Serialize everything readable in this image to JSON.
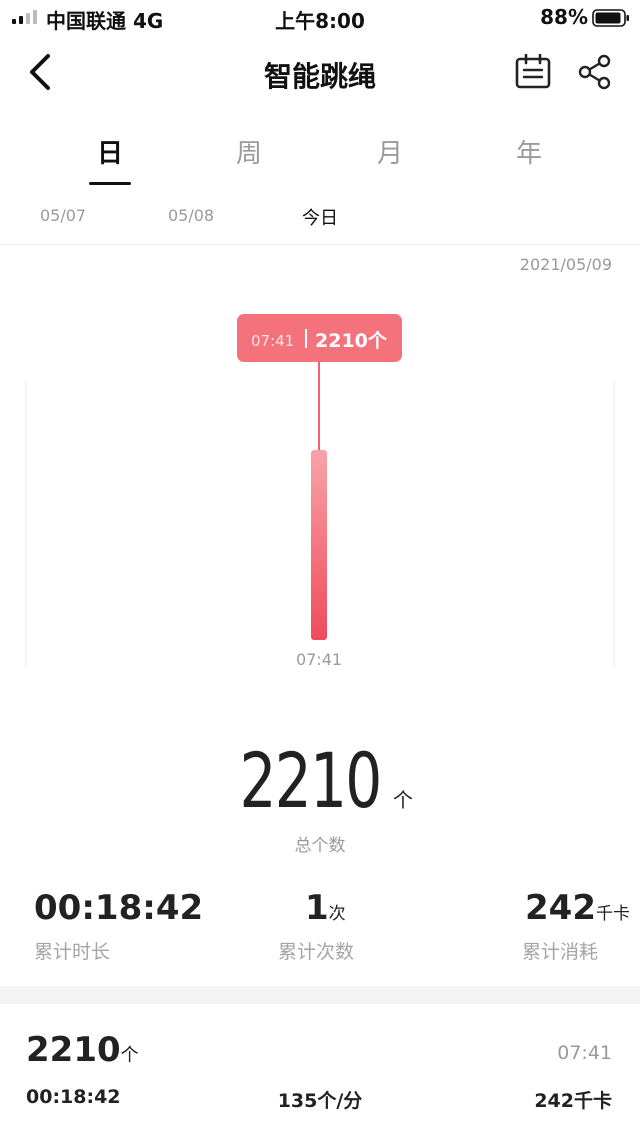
{
  "status_bar": {
    "carrier": "中国联通 4G",
    "time": "上午8:00",
    "battery": "88%"
  },
  "header": {
    "title": "智能跳绳"
  },
  "tabs": [
    {
      "label": "日"
    },
    {
      "label": "周"
    },
    {
      "label": "月"
    },
    {
      "label": "年"
    }
  ],
  "dates": [
    {
      "label": "05/07"
    },
    {
      "label": "05/08"
    },
    {
      "label": "今日"
    }
  ],
  "chart_date": "2021/05/09",
  "chart_data": {
    "type": "bar",
    "categories": [
      "07:41"
    ],
    "values": [
      2210
    ],
    "tooltip_time": "07:41",
    "tooltip_value": "2210个"
  },
  "summary": {
    "total": "2210",
    "total_unit": "个",
    "total_label": "总个数",
    "stats": [
      {
        "value": "00:18:42",
        "unit": "",
        "label": "累计时长"
      },
      {
        "value": "1",
        "unit": "次",
        "label": "累计次数"
      },
      {
        "value": "242",
        "unit": "千卡",
        "label": "累计消耗"
      }
    ]
  },
  "record": {
    "count": "2210",
    "count_unit": "个",
    "time": "07:41",
    "duration": "00:18:42",
    "rate": "135个/分",
    "calories": "242千卡"
  },
  "colors": {
    "accent": "#f2616c",
    "tooltip_bg": "#f3727b"
  }
}
